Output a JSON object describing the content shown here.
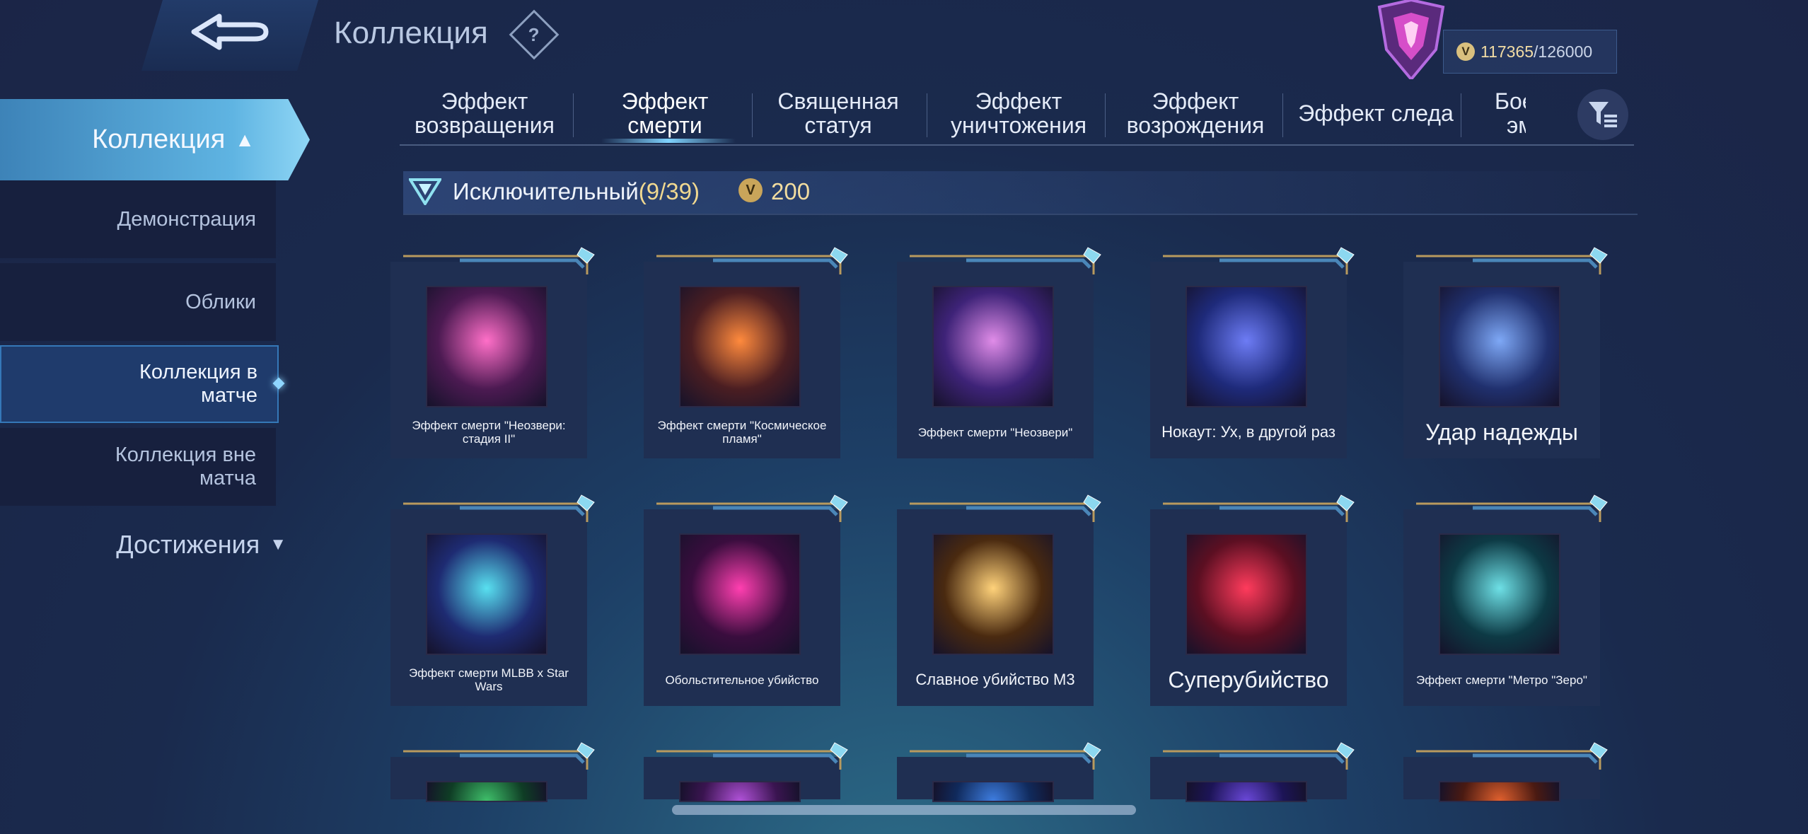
{
  "header": {
    "title": "Коллекция",
    "help_glyph": "?",
    "points": {
      "current": "117365",
      "max": "/126000"
    },
    "back_icon": "back-arrow-icon"
  },
  "sidebar": {
    "section": "Коллекция",
    "items": [
      {
        "label": "Демонстрация"
      },
      {
        "label": "Облики"
      },
      {
        "label": "Коллекция в матче"
      },
      {
        "label": "Коллекция вне матча"
      }
    ],
    "achievements": "Достижения"
  },
  "tabs": [
    {
      "label": "Эффект возвращения"
    },
    {
      "label": "Эффект смерти"
    },
    {
      "label": "Священная статуя"
    },
    {
      "label": "Эффект уничтожения"
    },
    {
      "label": "Эффект возрождения"
    },
    {
      "label": "Эффект следа"
    },
    {
      "label": "Боевые эмо"
    }
  ],
  "section": {
    "title": "Исключительный",
    "count": "(9/39)",
    "points": "200"
  },
  "items": [
    {
      "label": "Эффект смерти \"Неозвери: стадия II\"",
      "size": "small",
      "colors": [
        "#4c1a52",
        "#ff6fc8"
      ]
    },
    {
      "label": "Эффект смерти \"Космическое пламя\"",
      "size": "small",
      "colors": [
        "#4b1e22",
        "#ff8a3d"
      ]
    },
    {
      "label": "Эффект смерти \"Неозвери\"",
      "size": "small",
      "colors": [
        "#3e2378",
        "#e08ce8"
      ]
    },
    {
      "label": "Нокаут: Ух, в другой раз",
      "size": "mid",
      "colors": [
        "#1e2a7a",
        "#6d7cf5"
      ]
    },
    {
      "label": "Удар надежды",
      "size": "big",
      "colors": [
        "#20306e",
        "#7ea8f6"
      ]
    },
    {
      "label": "Эффект смерти MLBB x Star Wars",
      "size": "small",
      "colors": [
        "#1e2b72",
        "#58e0f0"
      ]
    },
    {
      "label": "Обольстительное убийство",
      "size": "small",
      "colors": [
        "#3a0d3e",
        "#ff3fb0"
      ]
    },
    {
      "label": "Славное убийство M3",
      "size": "mid",
      "colors": [
        "#4a2a10",
        "#ffd27a"
      ]
    },
    {
      "label": "Суперубийство",
      "size": "big",
      "colors": [
        "#5c0f22",
        "#ff3b5c"
      ]
    },
    {
      "label": "Эффект смерти \"Метро \"Зеро\"",
      "size": "small",
      "colors": [
        "#0d3a45",
        "#6ee0e6"
      ]
    }
  ],
  "partial_items": [
    {
      "colors": [
        "#0f3d25",
        "#3fbf6a"
      ]
    },
    {
      "colors": [
        "#3a1450",
        "#b052d8"
      ]
    },
    {
      "colors": [
        "#102a5c",
        "#3e7de0"
      ]
    },
    {
      "colors": [
        "#1c1456",
        "#6a48d8"
      ]
    },
    {
      "colors": [
        "#4a1a12",
        "#e0602e"
      ]
    }
  ]
}
